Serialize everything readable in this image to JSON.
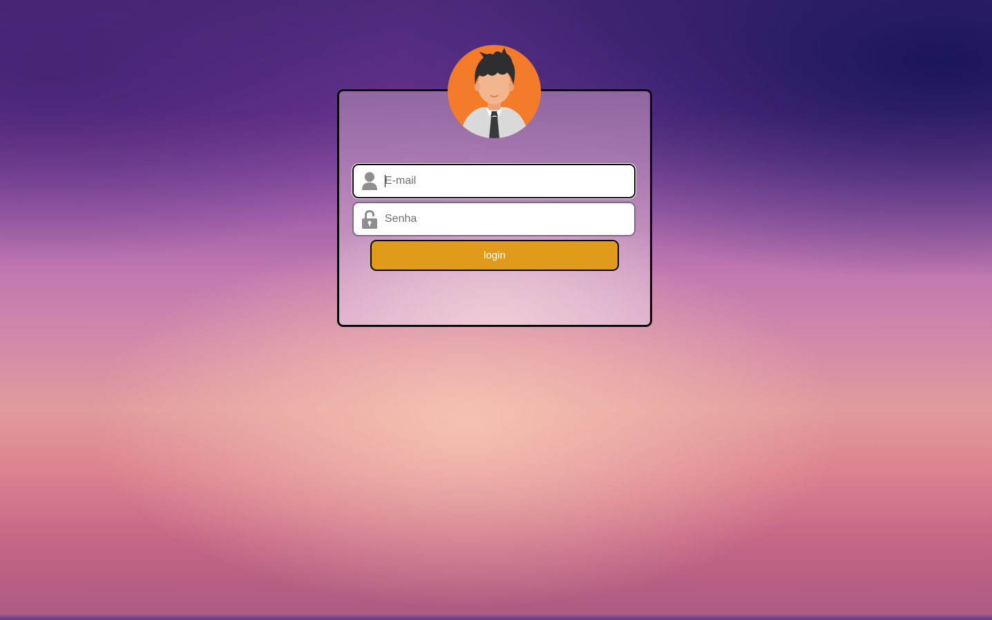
{
  "login_form": {
    "avatar_icon": "user-avatar-icon",
    "email": {
      "placeholder": "E-mail",
      "value": "",
      "icon": "user-icon"
    },
    "password": {
      "placeholder": "Senha",
      "value": "",
      "icon": "padlock-icon"
    },
    "submit_label": "login"
  },
  "colors": {
    "button": "#e19a1b",
    "avatar_bg": "#f47b2a",
    "card_border": "#0a0a0a"
  }
}
